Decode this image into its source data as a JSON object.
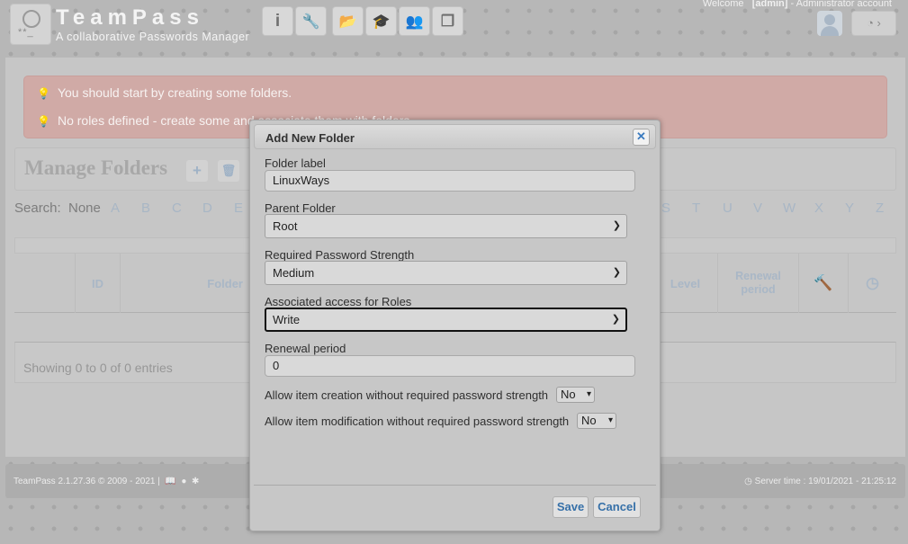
{
  "header": {
    "app_name": "TeamPass",
    "tagline": "A collaborative Passwords Manager",
    "welcome_prefix": "Welcome",
    "user": "[admin]",
    "account_type": "- Administrator account",
    "toolbar_icons": [
      "info-icon",
      "wrench-icon",
      "folder-icon",
      "graduation-cap-icon",
      "users-icon",
      "cubes-icon"
    ],
    "toolbar_glyphs": [
      "i",
      "🔧",
      "📂",
      "🎓",
      "👥",
      "❒"
    ],
    "dashboard_glyph": "◔ ›"
  },
  "alerts": [
    "You should start by creating some folders.",
    "No roles defined - create some and associate them with folders."
  ],
  "manage": {
    "title": "Manage Folders",
    "add_glyph": "+",
    "delete_glyph": "🗑"
  },
  "search": {
    "label": "Search:",
    "none": "None",
    "letters_left": [
      "A",
      "B",
      "C",
      "D",
      "E"
    ],
    "letters_right": [
      "S",
      "T",
      "U",
      "V",
      "W",
      "X",
      "Y",
      "Z"
    ]
  },
  "table": {
    "columns": {
      "id": "ID",
      "folder": "Folder",
      "level": "Level",
      "renewal": "Renewal period"
    },
    "entries_info": "Showing 0 to 0 of 0 entries"
  },
  "footer": {
    "version": "TeamPass 2.1.27.36 © 2009 - 2021  |",
    "server_time": "Server time : 19/01/2021 - 21:25:12"
  },
  "modal": {
    "title": "Add New Folder",
    "close_glyph": "✕",
    "folder_label": {
      "label": "Folder label",
      "value": "LinuxWays"
    },
    "parent_folder": {
      "label": "Parent Folder",
      "value": "Root"
    },
    "password_strength": {
      "label": "Required Password Strength",
      "value": "Medium"
    },
    "access_roles": {
      "label": "Associated access for Roles",
      "value": "Write"
    },
    "renewal_period": {
      "label": "Renewal period",
      "value": "0"
    },
    "allow_creation": {
      "label": "Allow item creation without required password strength",
      "value": "No"
    },
    "allow_modification": {
      "label": "Allow item modification without required password strength",
      "value": "No"
    },
    "save_label": "Save",
    "cancel_label": "Cancel"
  },
  "colors": {
    "alert_bg": "#d0aaa6",
    "link_blue": "#3670a8",
    "muted_blue": "#a9b7c6"
  }
}
